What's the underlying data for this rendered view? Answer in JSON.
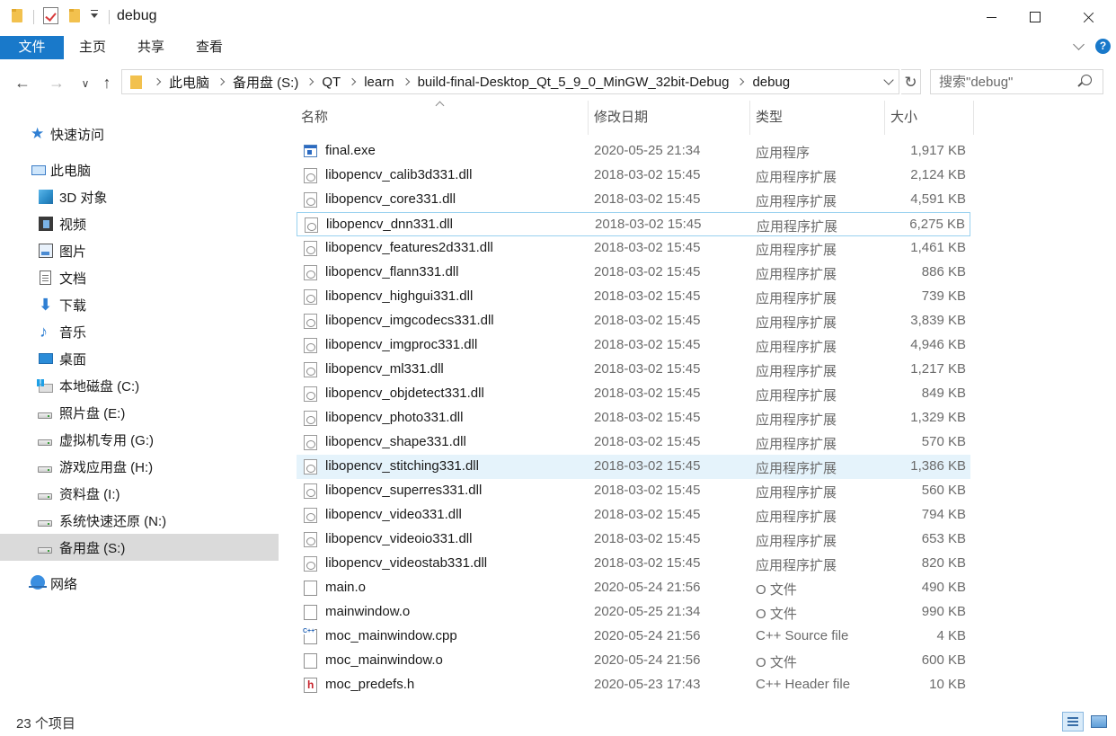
{
  "window": {
    "title": "debug"
  },
  "ribbon": {
    "tabs": [
      {
        "label": "文件",
        "active": true
      },
      {
        "label": "主页"
      },
      {
        "label": "共享"
      },
      {
        "label": "查看"
      }
    ],
    "help_label": "?"
  },
  "address": {
    "crumbs": [
      "此电脑",
      "备用盘 (S:)",
      "QT",
      "learn",
      "build-final-Desktop_Qt_5_9_0_MinGW_32bit-Debug",
      "debug"
    ]
  },
  "search": {
    "placeholder": "搜索\"debug\""
  },
  "sidebar": {
    "items": [
      {
        "label": "快速访问",
        "icon": "star-icon"
      },
      {
        "label": "此电脑",
        "icon": "computer-icon"
      },
      {
        "label": "3D 对象",
        "icon": "3d-objects-icon"
      },
      {
        "label": "视频",
        "icon": "video-icon"
      },
      {
        "label": "图片",
        "icon": "pictures-icon"
      },
      {
        "label": "文档",
        "icon": "documents-icon"
      },
      {
        "label": "下载",
        "icon": "download-icon"
      },
      {
        "label": "音乐",
        "icon": "music-icon"
      },
      {
        "label": "桌面",
        "icon": "desktop-icon"
      },
      {
        "label": "本地磁盘 (C:)",
        "icon": "windows-drive-icon"
      },
      {
        "label": "照片盘 (E:)",
        "icon": "drive-icon"
      },
      {
        "label": "虚拟机专用 (G:)",
        "icon": "drive-icon"
      },
      {
        "label": "游戏应用盘 (H:)",
        "icon": "drive-icon"
      },
      {
        "label": "资料盘 (I:)",
        "icon": "drive-icon"
      },
      {
        "label": "系统快速还原 (N:)",
        "icon": "drive-icon"
      },
      {
        "label": "备用盘 (S:)",
        "icon": "drive-icon",
        "selected": true
      },
      {
        "label": "网络",
        "icon": "network-icon"
      }
    ]
  },
  "columns": {
    "name": "名称",
    "date": "修改日期",
    "type": "类型",
    "size": "大小"
  },
  "files": [
    {
      "name": "final.exe",
      "date": "2020-05-25 21:34",
      "type": "应用程序",
      "size": "1,917 KB",
      "icon": "exe-icon"
    },
    {
      "name": "libopencv_calib3d331.dll",
      "date": "2018-03-02 15:45",
      "type": "应用程序扩展",
      "size": "2,124 KB",
      "icon": "dll-icon"
    },
    {
      "name": "libopencv_core331.dll",
      "date": "2018-03-02 15:45",
      "type": "应用程序扩展",
      "size": "4,591 KB",
      "icon": "dll-icon"
    },
    {
      "name": "libopencv_dnn331.dll",
      "date": "2018-03-02 15:45",
      "type": "应用程序扩展",
      "size": "6,275 KB",
      "icon": "dll-icon",
      "state": "focused"
    },
    {
      "name": "libopencv_features2d331.dll",
      "date": "2018-03-02 15:45",
      "type": "应用程序扩展",
      "size": "1,461 KB",
      "icon": "dll-icon"
    },
    {
      "name": "libopencv_flann331.dll",
      "date": "2018-03-02 15:45",
      "type": "应用程序扩展",
      "size": "886 KB",
      "icon": "dll-icon"
    },
    {
      "name": "libopencv_highgui331.dll",
      "date": "2018-03-02 15:45",
      "type": "应用程序扩展",
      "size": "739 KB",
      "icon": "dll-icon"
    },
    {
      "name": "libopencv_imgcodecs331.dll",
      "date": "2018-03-02 15:45",
      "type": "应用程序扩展",
      "size": "3,839 KB",
      "icon": "dll-icon"
    },
    {
      "name": "libopencv_imgproc331.dll",
      "date": "2018-03-02 15:45",
      "type": "应用程序扩展",
      "size": "4,946 KB",
      "icon": "dll-icon"
    },
    {
      "name": "libopencv_ml331.dll",
      "date": "2018-03-02 15:45",
      "type": "应用程序扩展",
      "size": "1,217 KB",
      "icon": "dll-icon"
    },
    {
      "name": "libopencv_objdetect331.dll",
      "date": "2018-03-02 15:45",
      "type": "应用程序扩展",
      "size": "849 KB",
      "icon": "dll-icon"
    },
    {
      "name": "libopencv_photo331.dll",
      "date": "2018-03-02 15:45",
      "type": "应用程序扩展",
      "size": "1,329 KB",
      "icon": "dll-icon"
    },
    {
      "name": "libopencv_shape331.dll",
      "date": "2018-03-02 15:45",
      "type": "应用程序扩展",
      "size": "570 KB",
      "icon": "dll-icon"
    },
    {
      "name": "libopencv_stitching331.dll",
      "date": "2018-03-02 15:45",
      "type": "应用程序扩展",
      "size": "1,386 KB",
      "icon": "dll-icon",
      "state": "hover"
    },
    {
      "name": "libopencv_superres331.dll",
      "date": "2018-03-02 15:45",
      "type": "应用程序扩展",
      "size": "560 KB",
      "icon": "dll-icon"
    },
    {
      "name": "libopencv_video331.dll",
      "date": "2018-03-02 15:45",
      "type": "应用程序扩展",
      "size": "794 KB",
      "icon": "dll-icon"
    },
    {
      "name": "libopencv_videoio331.dll",
      "date": "2018-03-02 15:45",
      "type": "应用程序扩展",
      "size": "653 KB",
      "icon": "dll-icon"
    },
    {
      "name": "libopencv_videostab331.dll",
      "date": "2018-03-02 15:45",
      "type": "应用程序扩展",
      "size": "820 KB",
      "icon": "dll-icon"
    },
    {
      "name": "main.o",
      "date": "2020-05-24 21:56",
      "type": "O 文件",
      "size": "490 KB",
      "icon": "file-icon"
    },
    {
      "name": "mainwindow.o",
      "date": "2020-05-25 21:34",
      "type": "O 文件",
      "size": "990 KB",
      "icon": "file-icon"
    },
    {
      "name": "moc_mainwindow.cpp",
      "date": "2020-05-24 21:56",
      "type": "C++ Source file",
      "size": "4 KB",
      "icon": "cpp-file-icon"
    },
    {
      "name": "moc_mainwindow.o",
      "date": "2020-05-24 21:56",
      "type": "O 文件",
      "size": "600 KB",
      "icon": "file-icon"
    },
    {
      "name": "moc_predefs.h",
      "date": "2020-05-23 17:43",
      "type": "C++ Header file",
      "size": "10 KB",
      "icon": "header-file-icon"
    }
  ],
  "status": {
    "item_count": "23 个项目"
  },
  "colors": {
    "accent": "#1979ca",
    "hover_row": "#e5f3fb",
    "selected_nav": "#dadada"
  }
}
